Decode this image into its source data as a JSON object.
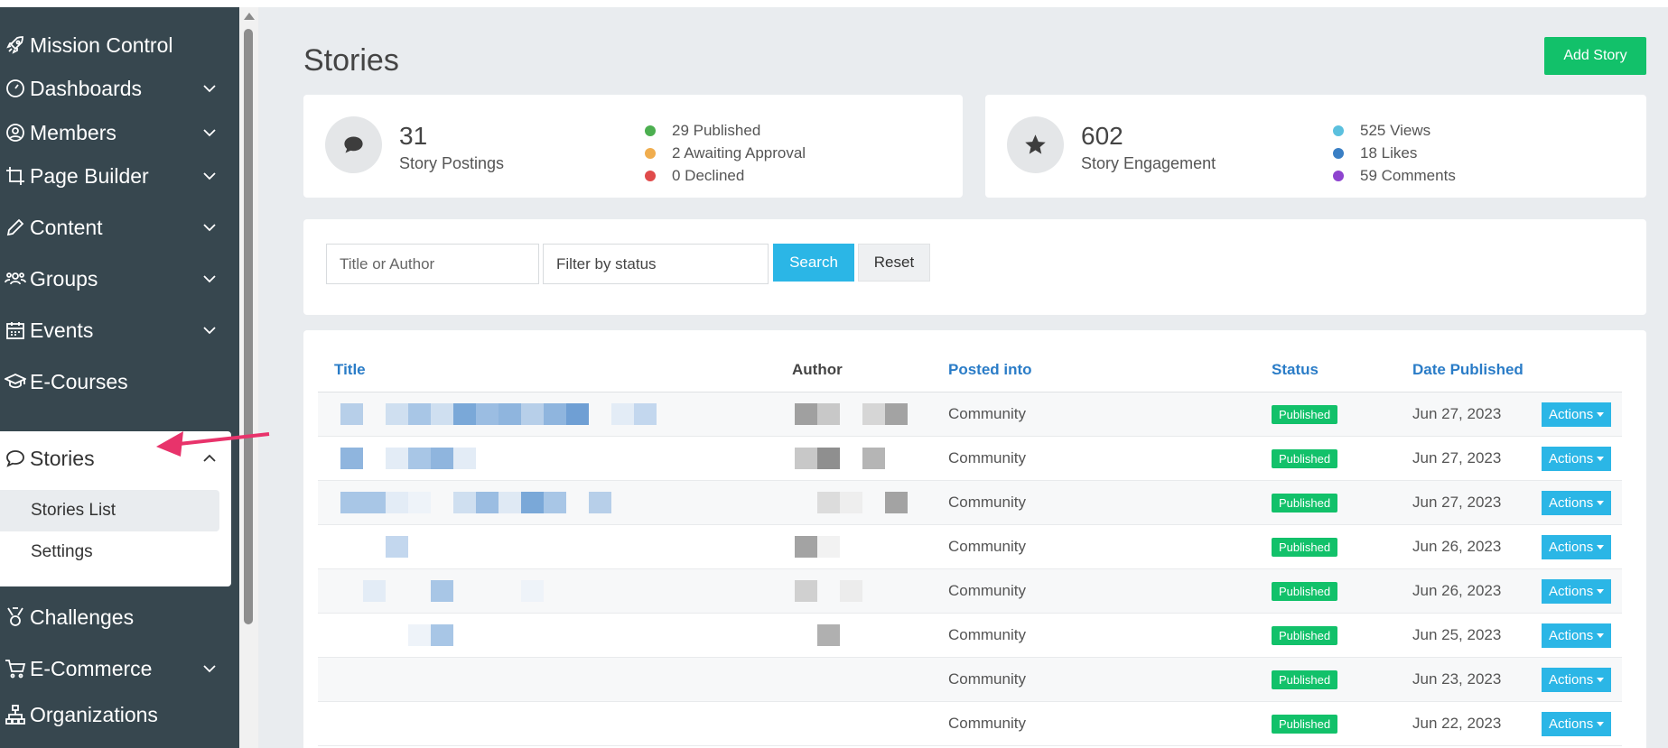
{
  "sidebar": {
    "items": [
      {
        "label": "Mission Control",
        "icon": "rocket-icon"
      },
      {
        "label": "Dashboards",
        "icon": "gauge-icon"
      },
      {
        "label": "Members",
        "icon": "user-circle-icon"
      },
      {
        "label": "Page Builder",
        "icon": "crop-icon"
      },
      {
        "label": "Content",
        "icon": "pencil-icon"
      },
      {
        "label": "Groups",
        "icon": "users-icon"
      },
      {
        "label": "Events",
        "icon": "calendar-icon"
      },
      {
        "label": "E-Courses",
        "icon": "graduation-cap-icon"
      },
      {
        "label": "Stories",
        "icon": "comment-icon"
      },
      {
        "label": "Challenges",
        "icon": "medal-icon"
      },
      {
        "label": "E-Commerce",
        "icon": "cart-icon"
      },
      {
        "label": "Organizations",
        "icon": "sitemap-icon"
      }
    ],
    "stories_sub": [
      {
        "label": "Stories List"
      },
      {
        "label": "Settings"
      }
    ]
  },
  "main": {
    "title": "Stories",
    "add_button": "Add Story",
    "postings": {
      "number": "31",
      "label": "Story Postings",
      "legend": [
        {
          "text": "29 Published",
          "color": "#4caf50"
        },
        {
          "text": "2 Awaiting Approval",
          "color": "#f0ad4e"
        },
        {
          "text": "0 Declined",
          "color": "#e04b4b"
        }
      ]
    },
    "engagement": {
      "number": "602",
      "label": "Story Engagement",
      "legend": [
        {
          "text": "525 Views",
          "color": "#5bc0de"
        },
        {
          "text": "18 Likes",
          "color": "#3a7fc4"
        },
        {
          "text": "59 Comments",
          "color": "#8e44cf"
        }
      ]
    },
    "filter": {
      "title_placeholder": "Title or Author",
      "status_placeholder": "Filter by status",
      "search_label": "Search",
      "reset_label": "Reset"
    },
    "table": {
      "headers": {
        "title": "Title",
        "author": "Author",
        "posted_into": "Posted into",
        "status": "Status",
        "date": "Date Published"
      },
      "rows": [
        {
          "posted_into": "Community",
          "status": "Published",
          "date": "Jun 27, 2023",
          "action": "Actions"
        },
        {
          "posted_into": "Community",
          "status": "Published",
          "date": "Jun 27, 2023",
          "action": "Actions"
        },
        {
          "posted_into": "Community",
          "status": "Published",
          "date": "Jun 27, 2023",
          "action": "Actions"
        },
        {
          "posted_into": "Community",
          "status": "Published",
          "date": "Jun 26, 2023",
          "action": "Actions"
        },
        {
          "posted_into": "Community",
          "status": "Published",
          "date": "Jun 26, 2023",
          "action": "Actions"
        },
        {
          "posted_into": "Community",
          "status": "Published",
          "date": "Jun 25, 2023",
          "action": "Actions"
        },
        {
          "posted_into": "Community",
          "status": "Published",
          "date": "Jun 23, 2023",
          "action": "Actions"
        },
        {
          "posted_into": "Community",
          "status": "Published",
          "date": "Jun 22, 2023",
          "action": "Actions"
        }
      ]
    }
  },
  "colors": {
    "sidebar_bg": "#37474f",
    "accent_green": "#12c16a",
    "accent_blue": "#2bb6e6",
    "link_blue": "#2a7cc7",
    "arrow_pink": "#e8336b"
  }
}
